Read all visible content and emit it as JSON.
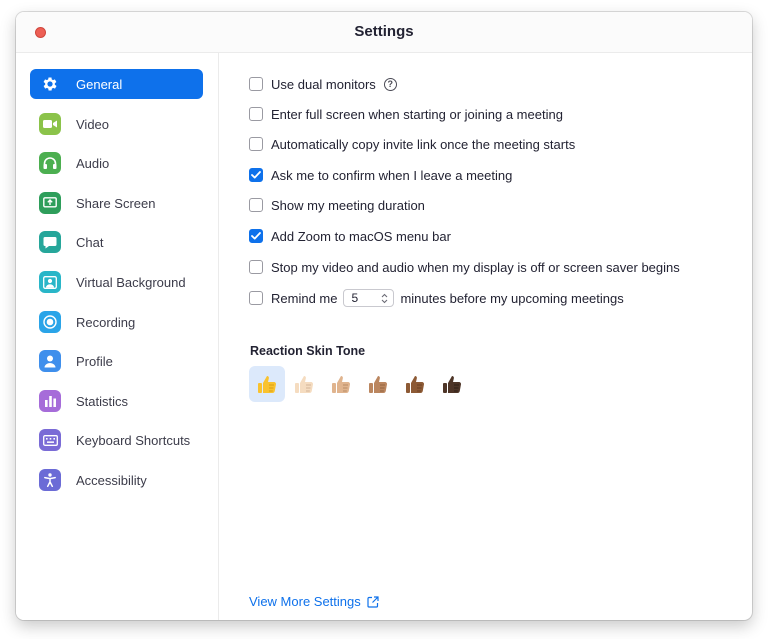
{
  "window": {
    "title": "Settings"
  },
  "sidebar": {
    "items": [
      {
        "label": "General",
        "icon": "gear-icon",
        "color": "#0e71eb",
        "active": true
      },
      {
        "label": "Video",
        "icon": "video-camera-icon",
        "color": "#8bc34a",
        "active": false
      },
      {
        "label": "Audio",
        "icon": "headphones-icon",
        "color": "#4caf50",
        "active": false
      },
      {
        "label": "Share Screen",
        "icon": "share-screen-icon",
        "color": "#2e9e5b",
        "active": false
      },
      {
        "label": "Chat",
        "icon": "chat-bubble-icon",
        "color": "#26a69a",
        "active": false
      },
      {
        "label": "Virtual Background",
        "icon": "virtual-background-icon",
        "color": "#29b6c8",
        "active": false
      },
      {
        "label": "Recording",
        "icon": "record-icon",
        "color": "#2aa4e8",
        "active": false
      },
      {
        "label": "Profile",
        "icon": "person-icon",
        "color": "#3f8fec",
        "active": false
      },
      {
        "label": "Statistics",
        "icon": "bar-chart-icon",
        "color": "#a66cd9",
        "active": false
      },
      {
        "label": "Keyboard Shortcuts",
        "icon": "keyboard-icon",
        "color": "#7a6bd6",
        "active": false
      },
      {
        "label": "Accessibility",
        "icon": "accessibility-icon",
        "color": "#6b6bd6",
        "active": false
      }
    ]
  },
  "general": {
    "options": [
      {
        "label": "Use dual monitors",
        "checked": false,
        "help": "?"
      },
      {
        "label": "Enter full screen when starting or joining a meeting",
        "checked": false
      },
      {
        "label": "Automatically copy invite link once the meeting starts",
        "checked": false
      },
      {
        "label": "Ask me to confirm when I leave a meeting",
        "checked": true
      },
      {
        "label": "Show my meeting duration",
        "checked": false
      },
      {
        "label": "Add Zoom to macOS menu bar",
        "checked": true
      },
      {
        "label": "Stop my video and audio when my display is off or screen saver begins",
        "checked": false
      }
    ],
    "reminder": {
      "checked": false,
      "prefix": "Remind me",
      "minutes": "5",
      "suffix": "minutes before my upcoming meetings"
    },
    "reaction_skin_tone": {
      "title": "Reaction Skin Tone",
      "selected_index": 0,
      "tones": [
        {
          "name": "default",
          "color": "#f9c22e"
        },
        {
          "name": "light",
          "color": "#f5dcc0"
        },
        {
          "name": "medium-light",
          "color": "#e0b48e"
        },
        {
          "name": "medium",
          "color": "#bb865f"
        },
        {
          "name": "medium-dark",
          "color": "#8d5a35"
        },
        {
          "name": "dark",
          "color": "#4e3527"
        }
      ]
    },
    "view_more_label": "View More Settings"
  },
  "colors": {
    "accent": "#0e71eb",
    "close_button": "#ed5f55"
  }
}
